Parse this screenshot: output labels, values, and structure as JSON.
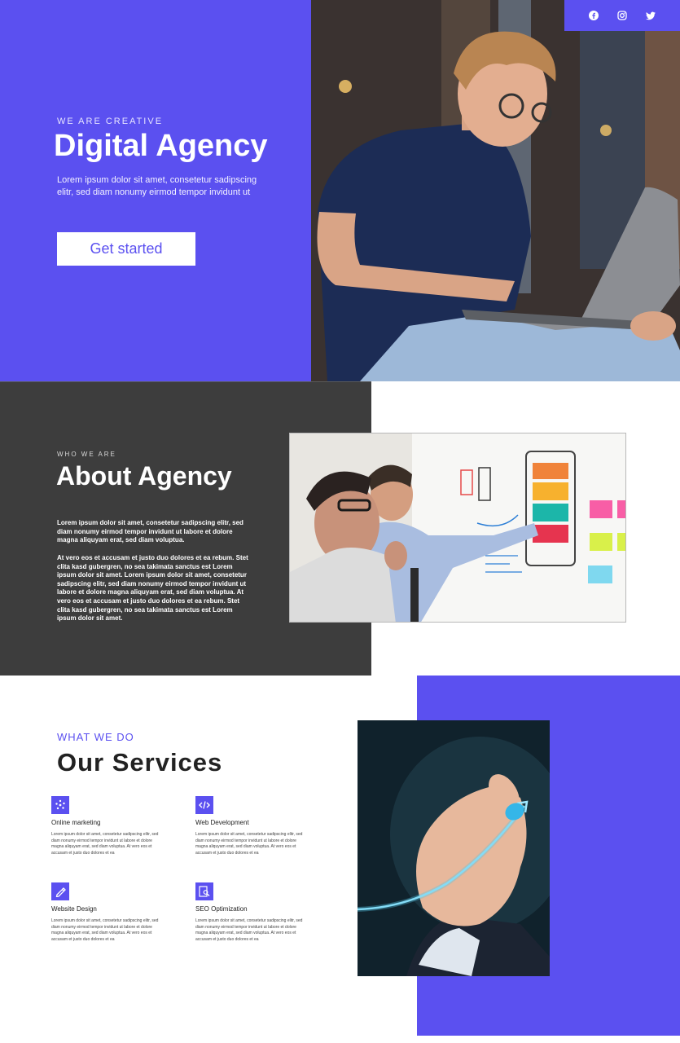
{
  "colors": {
    "accent": "#5b50f0",
    "dark": "#3d3d3d",
    "white": "#ffffff"
  },
  "social": [
    {
      "icon": "facebook-icon"
    },
    {
      "icon": "instagram-icon"
    },
    {
      "icon": "twitter-icon"
    }
  ],
  "hero": {
    "eyebrow": "WE ARE CREATIVE",
    "title": "Digital Agency",
    "description": "Lorem ipsum dolor sit amet, consetetur sadipscing elitr, sed diam nonumy eirmod tempor invidunt ut",
    "cta_label": "Get started"
  },
  "about": {
    "eyebrow": "WHO WE ARE",
    "title": "About Agency",
    "paragraph1": "Lorem ipsum dolor sit amet, consetetur sadipscing elitr, sed diam nonumy eirmod tempor invidunt ut labore et dolore magna aliquyam erat, sed diam voluptua.",
    "paragraph2": "At vero eos et accusam et justo duo dolores et ea rebum. Stet clita kasd gubergren, no sea takimata sanctus est Lorem ipsum dolor sit amet. Lorem ipsum dolor sit amet, consetetur sadipscing elitr, sed diam nonumy eirmod tempor invidunt ut labore et dolore magna aliquyam erat, sed diam voluptua. At vero eos et accusam et justo duo dolores et ea rebum. Stet clita kasd gubergren, no sea takimata sanctus est Lorem ipsum dolor sit amet."
  },
  "services": {
    "eyebrow": "WHAT WE DO",
    "title": "Our Services",
    "items": [
      {
        "name": "Online marketing",
        "icon": "marketing-icon",
        "description": "Lorem ipsum dolor sit amet, consetetur sadipscing elitr, sed diam nonumy eirmod tempor invidunt ut labore et dolore magna aliquyam erat, sed diam voluptua. At vero eos et accusam et justo duo dolores et ea"
      },
      {
        "name": "Web Development",
        "icon": "code-icon",
        "description": "Lorem ipsum dolor sit amet, consetetur sadipscing elitr, sed diam nonumy eirmod tempor invidunt ut labore et dolore magna aliquyam erat, sed diam voluptua. At vero eos et accusam et justo duo dolores et ea"
      },
      {
        "name": "Website Design",
        "icon": "design-icon",
        "description": "Lorem ipsum dolor sit amet, consetetur sadipscing elitr, sed diam nonumy eirmod tempor invidunt ut labore et dolore magna aliquyam erat, sed diam voluptua. At vero eos et accusam et justo duo dolores et ea"
      },
      {
        "name": "SEO Optimization",
        "icon": "seo-icon",
        "description": "Lorem ipsum dolor sit amet, consetetur sadipscing elitr, sed diam nonumy eirmod tempor invidunt ut labore et dolore magna aliquyam erat, sed diam voluptua. At vero eos et accusam et justo duo dolores et ea"
      }
    ]
  }
}
